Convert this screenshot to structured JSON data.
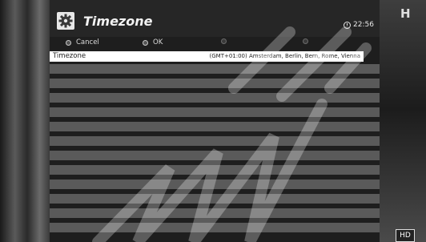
{
  "header": {
    "title": "Timezone",
    "time": "22:56"
  },
  "softkeys": [
    {
      "label": "Cancel"
    },
    {
      "label": "OK"
    }
  ],
  "setting": {
    "label": "Timezone",
    "value": "(GMT+01:00) Amsterdam, Berlin, Bern, Rome, Vienna"
  },
  "background": {
    "right_text": "H",
    "hd_badge": "HD"
  },
  "colors": {
    "panel": "#1e1e1e",
    "stripe": "#5a5a5a",
    "selected": "#ffffff"
  }
}
